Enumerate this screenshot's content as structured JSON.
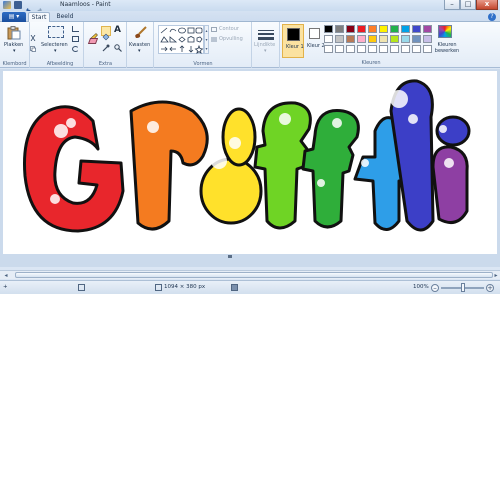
{
  "window": {
    "title": "Naamloos - Paint"
  },
  "tabs": [
    {
      "label": "Start"
    },
    {
      "label": "Beeld"
    }
  ],
  "ribbon": {
    "clipboard": {
      "paste_label": "Plakken",
      "group_label": "Klembord"
    },
    "image": {
      "select_label": "Selecteren",
      "group_label": "Afbeelding"
    },
    "tools": {
      "group_label": "Extra",
      "text_tool_glyph": "A"
    },
    "brushes": {
      "label": "Kwasten"
    },
    "shapes": {
      "group_label": "Vormen",
      "outline_label": "Contour",
      "fill_label": "Opvulling"
    },
    "size": {
      "label": "Lijndikte"
    },
    "colors": {
      "color1_label": "Kleur 1",
      "color2_label": "Kleur 2",
      "edit_label": "Kleuren bewerken",
      "group_label": "Kleuren",
      "color1_value": "#000000",
      "color2_value": "#ffffff",
      "palette_row1": [
        "#000000",
        "#7f7f7f",
        "#880015",
        "#ed1c24",
        "#ff7f27",
        "#fff200",
        "#22b14c",
        "#00a2e8",
        "#3f48cc",
        "#a349a4"
      ],
      "palette_row2": [
        "#ffffff",
        "#c3c3c3",
        "#b97a57",
        "#ffaec9",
        "#ffc90e",
        "#efe4b0",
        "#b5e61d",
        "#99d9ea",
        "#7092be",
        "#c8bfe7"
      ],
      "palette_row3": [
        "#ffffff",
        "#ffffff",
        "#ffffff",
        "#ffffff",
        "#ffffff",
        "#ffffff",
        "#ffffff",
        "#ffffff",
        "#ffffff",
        "#ffffff"
      ]
    }
  },
  "statusbar": {
    "image_size": "1094 × 380 px",
    "zoom": "100%"
  },
  "artwork": {
    "letter_colors": [
      "#e8262c",
      "#f47b20",
      "#ffe12b",
      "#6fd425",
      "#2fae3a",
      "#2e9ee8",
      "#3c3fc7",
      "#8e3fa3"
    ]
  }
}
